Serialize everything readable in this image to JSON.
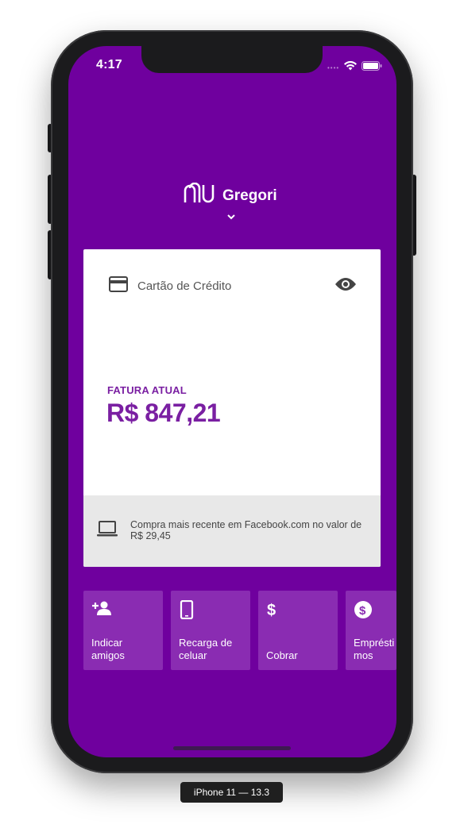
{
  "status_bar": {
    "time": "4:17"
  },
  "header": {
    "user_name": "Gregori"
  },
  "card": {
    "title": "Cartão de Crédito",
    "invoice_label": "FATURA ATUAL",
    "invoice_value": "R$ 847,21",
    "recent_purchase": "Compra mais recente em Facebook.com no valor de R$ 29,45"
  },
  "shortcuts": [
    {
      "label": "Indicar\namigos",
      "icon": "add-person-icon"
    },
    {
      "label": "Recarga de\nceluar",
      "icon": "phone-icon"
    },
    {
      "label": "Cobrar",
      "icon": "dollar-icon"
    },
    {
      "label": "Empréstimos",
      "icon": "money-circle-icon"
    }
  ],
  "device": {
    "label": "iPhone 11 — 13.3"
  },
  "colors": {
    "brand_purple": "#6f009e",
    "tile_purple": "#8a2cb2",
    "accent_text": "#7a1fa2"
  }
}
